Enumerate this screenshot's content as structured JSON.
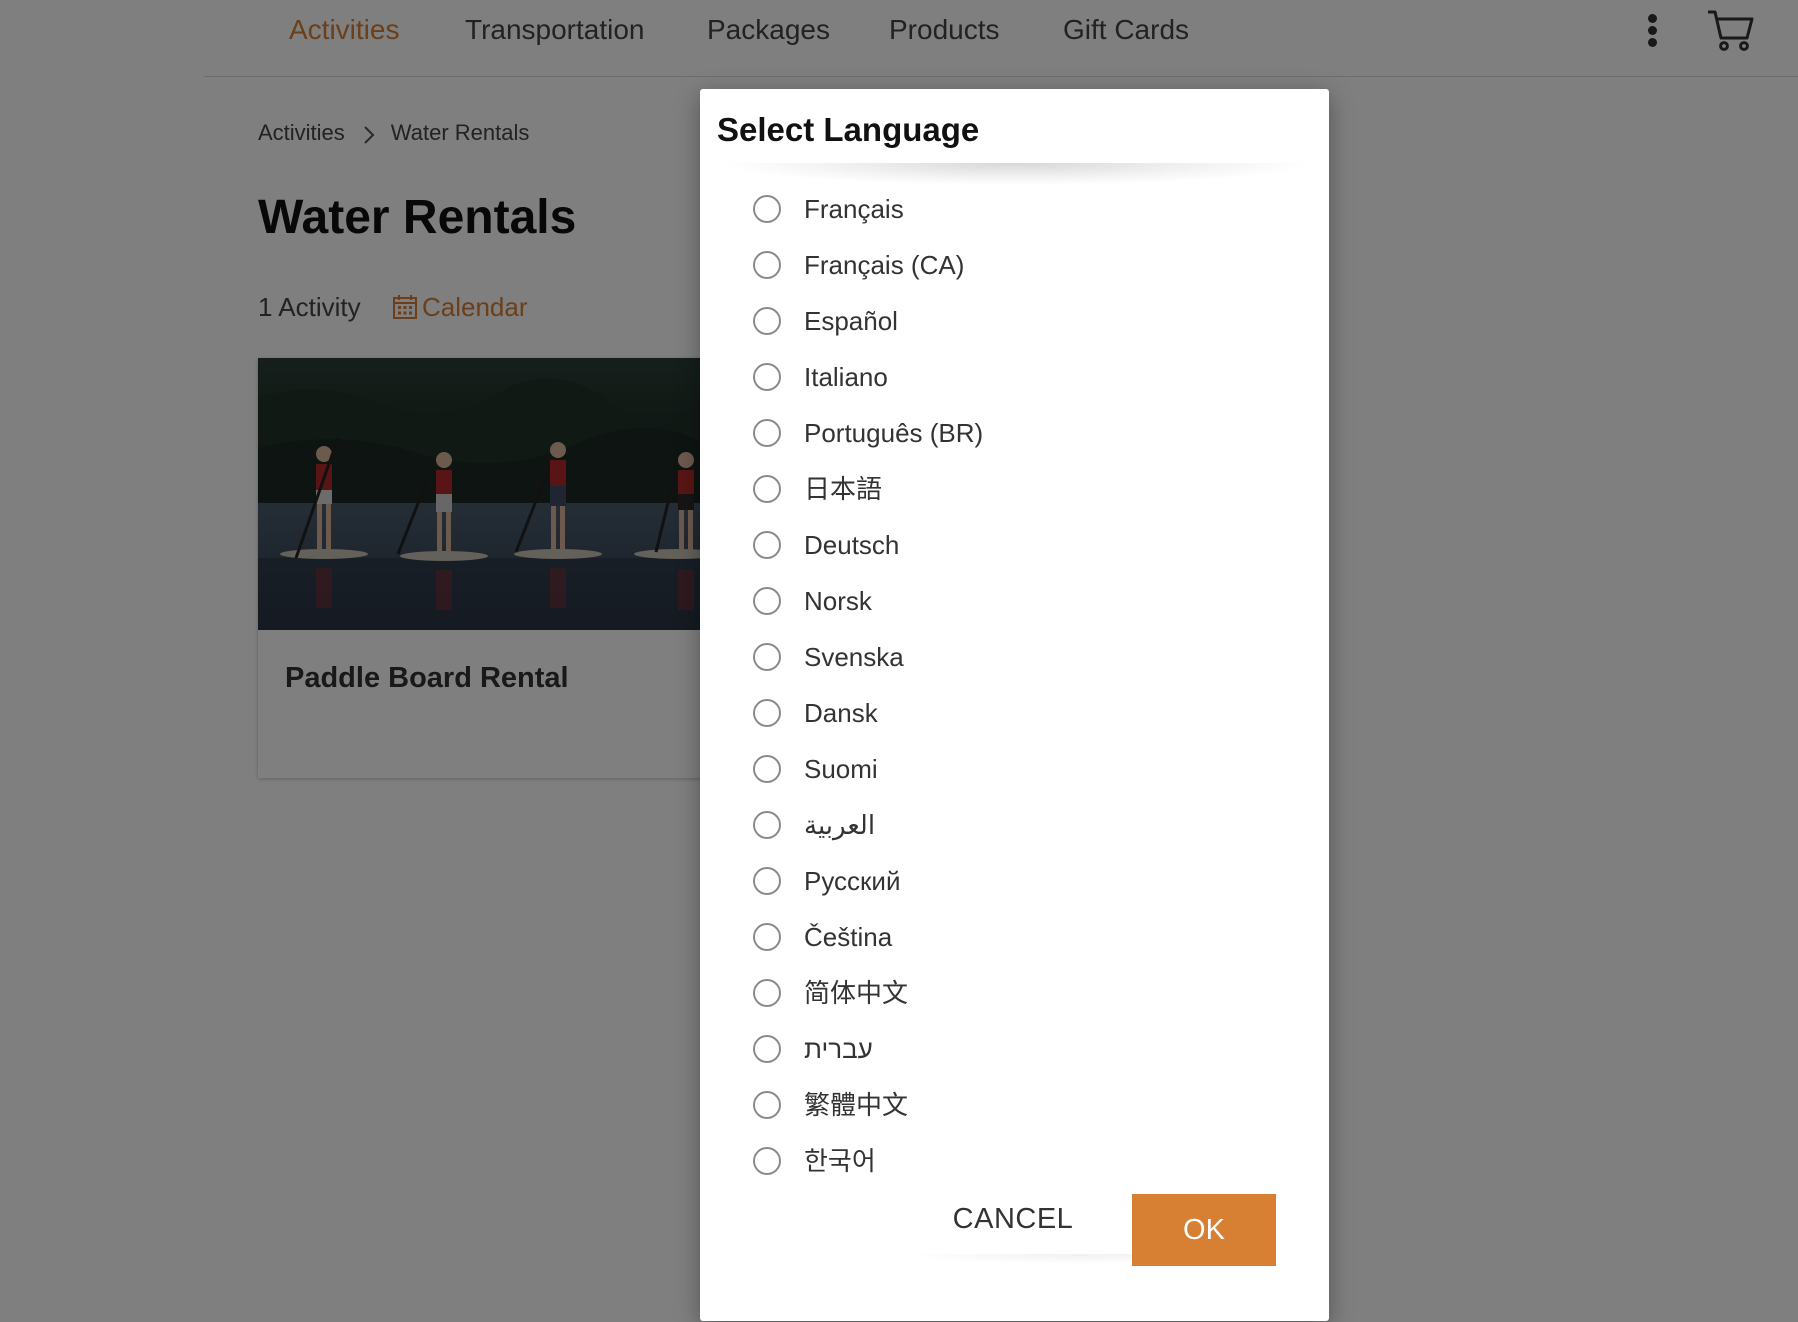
{
  "nav": {
    "items": [
      {
        "label": "Activities",
        "active": true
      },
      {
        "label": "Transportation",
        "active": false
      },
      {
        "label": "Packages",
        "active": false
      },
      {
        "label": "Products",
        "active": false
      },
      {
        "label": "Gift Cards",
        "active": false
      }
    ],
    "more_icon": "kebab-vertical-icon",
    "cart_icon": "shopping-cart-icon"
  },
  "breadcrumb": {
    "items": [
      "Activities",
      "Water Rentals"
    ],
    "separator_icon": "chevron-right-icon"
  },
  "page": {
    "title": "Water Rentals",
    "activity_count": "1 Activity",
    "calendar_label": "Calendar",
    "calendar_icon": "calendar-icon"
  },
  "card": {
    "title": "Paddle Board Rental",
    "image_alt": "paddle-boarders-on-lake-image"
  },
  "dialog": {
    "title": "Select Language",
    "languages": [
      "Français",
      "Français (CA)",
      "Español",
      "Italiano",
      "Português (BR)",
      "日本語",
      "Deutsch",
      "Norsk",
      "Svenska",
      "Dansk",
      "Suomi",
      "العربية",
      "Русский",
      "Čeština",
      "简体中文",
      "עברית",
      "繁體中文",
      "한국어"
    ],
    "cancel_label": "CANCEL",
    "ok_label": "OK"
  },
  "colors": {
    "accent": "#d77f33",
    "overlay": "rgba(0,0,0,0.5)",
    "text": "#333333"
  }
}
